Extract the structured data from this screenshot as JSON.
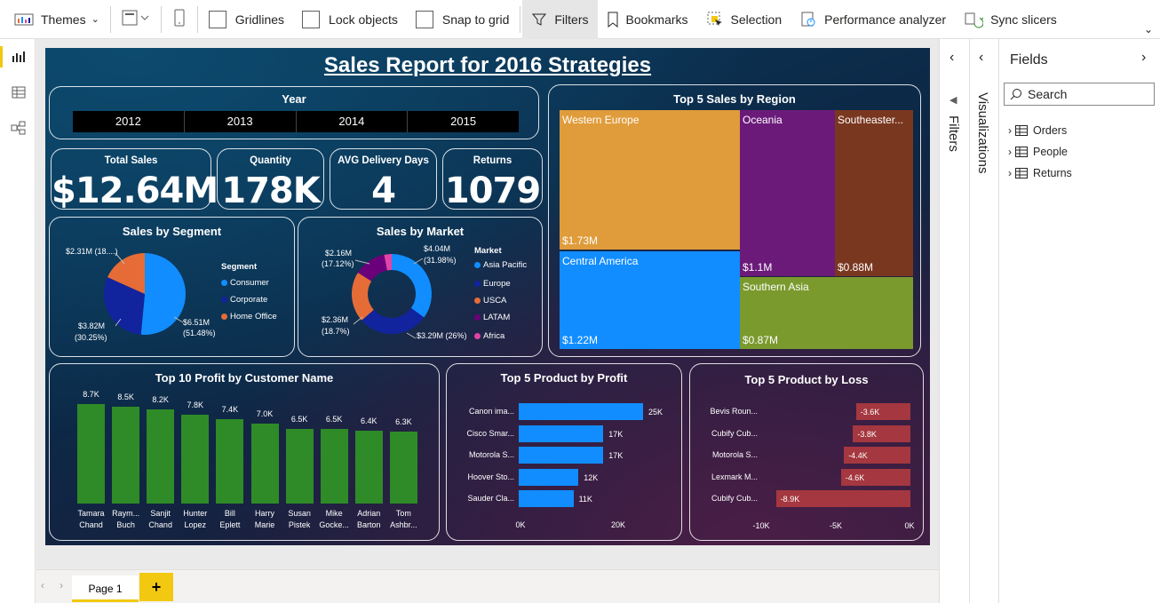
{
  "ribbon": {
    "themes": "Themes",
    "gridlines": "Gridlines",
    "lock_objects": "Lock objects",
    "snap_to_grid": "Snap to grid",
    "filters": "Filters",
    "bookmarks": "Bookmarks",
    "selection": "Selection",
    "performance_analyzer": "Performance analyzer",
    "sync_slicers": "Sync slicers"
  },
  "report": {
    "title": "Sales Report for 2016 Strategies",
    "year_slicer": {
      "title": "Year",
      "years": [
        "2012",
        "2013",
        "2014",
        "2015"
      ]
    },
    "kpis": [
      {
        "label": "Total Sales",
        "value": "$12.64M"
      },
      {
        "label": "Quantity",
        "value": "178K"
      },
      {
        "label": "AVG Delivery Days",
        "value": "4"
      },
      {
        "label": "Returns",
        "value": "1079"
      }
    ],
    "segment": {
      "title": "Sales by Segment",
      "legend_title": "Segment",
      "legend": [
        "Consumer",
        "Corporate",
        "Home Office"
      ],
      "labels": {
        "home_office": "$2.31M (18....)",
        "corporate_a": "$3.82M",
        "corporate_b": "(30.25%)",
        "consumer_a": "$6.51M",
        "consumer_b": "(51.48%)"
      }
    },
    "market": {
      "title": "Sales by Market",
      "legend_title": "Market",
      "legend": [
        "Asia Pacific",
        "Europe",
        "USCA",
        "LATAM",
        "Africa"
      ],
      "labels": {
        "ap_a": "$4.04M",
        "ap_b": "(31.98%)",
        "africa_a": "$2.16M",
        "africa_b": "(17.12%)",
        "usca_a": "$2.36M",
        "usca_b": "(18.7%)",
        "europe": "$3.29M (26%)"
      }
    },
    "region": {
      "title": "Top 5 Sales by Region",
      "tiles": [
        {
          "name": "Western Europe",
          "value": "$1.73M"
        },
        {
          "name": "Central America",
          "value": "$1.22M"
        },
        {
          "name": "Oceania",
          "value": "$1.1M"
        },
        {
          "name": "Southeaster...",
          "value": "$0.88M"
        },
        {
          "name": "Southern Asia",
          "value": "$0.87M"
        }
      ]
    },
    "customers": {
      "title": "Top 10 Profit by Customer Name"
    },
    "top_products": {
      "title": "Top 5 Product by Profit",
      "ticks": [
        "0K",
        "20K"
      ]
    },
    "loss_products": {
      "title": "Top 5 Product by Loss",
      "ticks": [
        "-10K",
        "-5K",
        "0K"
      ]
    }
  },
  "chart_data": [
    {
      "type": "pie",
      "title": "Sales by Segment",
      "categories": [
        "Consumer",
        "Corporate",
        "Home Office"
      ],
      "values": [
        6.51,
        3.82,
        2.31
      ],
      "unit": "$M",
      "colors": [
        "#118dff",
        "#12239e",
        "#e66c37"
      ]
    },
    {
      "type": "pie",
      "title": "Sales by Market",
      "categories": [
        "Asia Pacific",
        "Europe",
        "USCA",
        "LATAM",
        "Africa"
      ],
      "values": [
        4.04,
        3.29,
        2.36,
        1.5,
        0.35
      ],
      "unit": "$M",
      "colors": [
        "#118dff",
        "#12239e",
        "#e66c37",
        "#6b007b",
        "#e044a7"
      ]
    },
    {
      "type": "bar",
      "title": "Top 10 Profit by Customer Name",
      "categories": [
        "Tamara Chand",
        "Raym... Buch",
        "Sanjit Chand",
        "Hunter Lopez",
        "Bill Eplett",
        "Harry Marie",
        "Susan Pistek",
        "Mike Gocke...",
        "Adrian Barton",
        "Tom Ashbr..."
      ],
      "values": [
        8.7,
        8.5,
        8.2,
        7.8,
        7.4,
        7.0,
        6.5,
        6.5,
        6.4,
        6.3
      ],
      "value_labels": [
        "8.7K",
        "8.5K",
        "8.2K",
        "7.8K",
        "7.4K",
        "7.0K",
        "6.5K",
        "6.5K",
        "6.4K",
        "6.3K"
      ],
      "color": "#2e8b27"
    },
    {
      "type": "bar",
      "orientation": "horizontal",
      "title": "Top 5 Product by Profit",
      "categories": [
        "Canon ima...",
        "Cisco Smar...",
        "Motorola S...",
        "Hoover Sto...",
        "Sauder Cla..."
      ],
      "values": [
        25,
        17,
        17,
        12,
        11
      ],
      "value_labels": [
        "25K",
        "17K",
        "17K",
        "12K",
        "11K"
      ],
      "xlim": [
        0,
        25
      ],
      "color": "#118dff"
    },
    {
      "type": "bar",
      "orientation": "horizontal",
      "title": "Top 5 Product by Loss",
      "categories": [
        "Bevis Roun...",
        "Cubify Cub...",
        "Motorola S...",
        "Lexmark M...",
        "Cubify Cub..."
      ],
      "values": [
        -3.6,
        -3.8,
        -4.4,
        -4.6,
        -8.9
      ],
      "value_labels": [
        "-3.6K",
        "-3.8K",
        "-4.4K",
        "-4.6K",
        "-8.9K"
      ],
      "xlim": [
        -10,
        0
      ],
      "color": "#a4373f"
    }
  ],
  "panels": {
    "filters": "Filters",
    "visualizations": "Visualizations",
    "fields_title": "Fields",
    "search_placeholder": "Search",
    "tables": [
      "Orders",
      "People",
      "Returns"
    ]
  },
  "footer": {
    "page_tab": "Page 1",
    "add_tab": "+"
  }
}
